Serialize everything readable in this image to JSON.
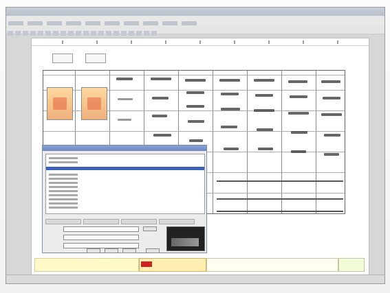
{
  "window": {
    "title": ""
  },
  "sheet": {
    "buttons": [
      "",
      ""
    ]
  },
  "dialog": {
    "title": ""
  },
  "status": {
    "text": ""
  },
  "colors": {
    "selection": "#3b62b9",
    "dialog_title": "#6c86c2",
    "thumb_orange": "#f0b07c",
    "footer_yellow": "#fff9c8",
    "footer_red": "#cc2222"
  },
  "icons": [
    "application-icon",
    "toolbar-icons",
    "diagram-thumbnail-icon"
  ]
}
